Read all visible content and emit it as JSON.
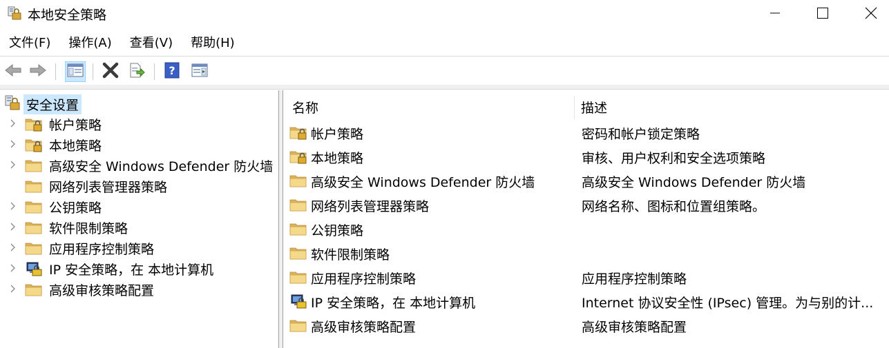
{
  "window": {
    "title": "本地安全策略",
    "icon": "security-policy-icon"
  },
  "menu": [
    {
      "label": "文件(F)"
    },
    {
      "label": "操作(A)"
    },
    {
      "label": "查看(V)"
    },
    {
      "label": "帮助(H)"
    }
  ],
  "toolbar": {
    "buttons": [
      "back-icon",
      "forward-icon",
      "show-hide-tree-icon",
      "delete-icon",
      "export-list-icon",
      "help-icon",
      "show-hide-action-pane-icon"
    ]
  },
  "tree": {
    "root": {
      "label": "安全设置"
    },
    "items": [
      {
        "label": "帐户策略",
        "icon": "folder-lock",
        "expandable": true
      },
      {
        "label": "本地策略",
        "icon": "folder-lock",
        "expandable": true
      },
      {
        "label": "高级安全 Windows Defender 防火墙",
        "icon": "folder",
        "expandable": true
      },
      {
        "label": "网络列表管理器策略",
        "icon": "folder",
        "expandable": false
      },
      {
        "label": "公钥策略",
        "icon": "folder",
        "expandable": true
      },
      {
        "label": "软件限制策略",
        "icon": "folder",
        "expandable": true
      },
      {
        "label": "应用程序控制策略",
        "icon": "folder",
        "expandable": true
      },
      {
        "label": "IP 安全策略，在 本地计算机",
        "icon": "ipsec",
        "expandable": true
      },
      {
        "label": "高级审核策略配置",
        "icon": "folder",
        "expandable": true
      }
    ]
  },
  "list": {
    "columns": {
      "name": "名称",
      "desc": "描述"
    },
    "rows": [
      {
        "name": "帐户策略",
        "desc": "密码和帐户锁定策略",
        "icon": "folder-lock"
      },
      {
        "name": "本地策略",
        "desc": "审核、用户权利和安全选项策略",
        "icon": "folder-lock"
      },
      {
        "name": "高级安全 Windows Defender 防火墙",
        "desc": "高级安全 Windows Defender 防火墙",
        "icon": "folder"
      },
      {
        "name": "网络列表管理器策略",
        "desc": "网络名称、图标和位置组策略。",
        "icon": "folder"
      },
      {
        "name": "公钥策略",
        "desc": "",
        "icon": "folder"
      },
      {
        "name": "软件限制策略",
        "desc": "",
        "icon": "folder"
      },
      {
        "name": "应用程序控制策略",
        "desc": "应用程序控制策略",
        "icon": "folder"
      },
      {
        "name": "IP 安全策略，在 本地计算机",
        "desc": "Internet 协议安全性 (IPsec) 管理。为与别的计...",
        "icon": "ipsec"
      },
      {
        "name": "高级审核策略配置",
        "desc": "高级审核策略配置",
        "icon": "folder"
      }
    ]
  },
  "colors": {
    "selection": "#cce8ff",
    "folder": "#f5d98a",
    "folder_dark": "#dcb35c"
  }
}
